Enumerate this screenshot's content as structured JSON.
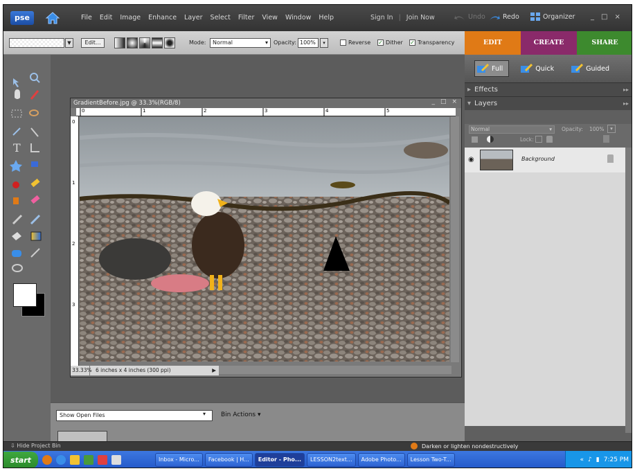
{
  "app": {
    "logo": "pse",
    "menus": [
      "File",
      "Edit",
      "Image",
      "Enhance",
      "Layer",
      "Select",
      "Filter",
      "View",
      "Window",
      "Help"
    ],
    "sign_in": "Sign In",
    "join_now": "Join Now",
    "undo": "Undo",
    "redo": "Redo",
    "organizer": "Organizer"
  },
  "options": {
    "edit_label": "Edit...",
    "mode_label": "Mode:",
    "mode_value": "Normal",
    "opacity_label": "Opacity:",
    "opacity_value": "100%",
    "reverse": "Reverse",
    "dither": "Dither",
    "transparency": "Transparency"
  },
  "tabs": [
    "EDIT",
    "CREATE",
    "SHARE"
  ],
  "modes": [
    "Full",
    "Quick",
    "Guided"
  ],
  "panel": {
    "effects": "Effects",
    "layers": "Layers",
    "blend_mode": "Normal",
    "opacity_label": "Opacity:",
    "opacity_value": "100%",
    "lock_label": "Lock:",
    "layer_name": "Background"
  },
  "document": {
    "title": "GradientBefore.jpg @ 33.3%(RGB/8)",
    "zoom": "33.33%",
    "dims": "6 inches x 4 inches (300 ppi)",
    "ruler_h": [
      "0",
      "1",
      "2",
      "3",
      "4",
      "5"
    ],
    "ruler_v": [
      "0",
      "1",
      "2",
      "3"
    ]
  },
  "bin": {
    "select_value": "Show Open Files",
    "actions": "Bin Actions ▾",
    "hide": "Hide Project Bin"
  },
  "status_tip": "Darken or lighten nondestructively",
  "taskbar": {
    "start": "start",
    "buttons": [
      "Inbox - Micro...",
      "Facebook | H...",
      "Editor - Pho...",
      "LESSON2text...",
      "Adobe Photo...",
      "Lesson Two-T..."
    ],
    "active_index": 2,
    "time": "7:25 PM"
  },
  "colors": {
    "edit_tab": "#e07a16",
    "create_tab": "#8a2a6a",
    "share_tab": "#3d8a2e"
  }
}
